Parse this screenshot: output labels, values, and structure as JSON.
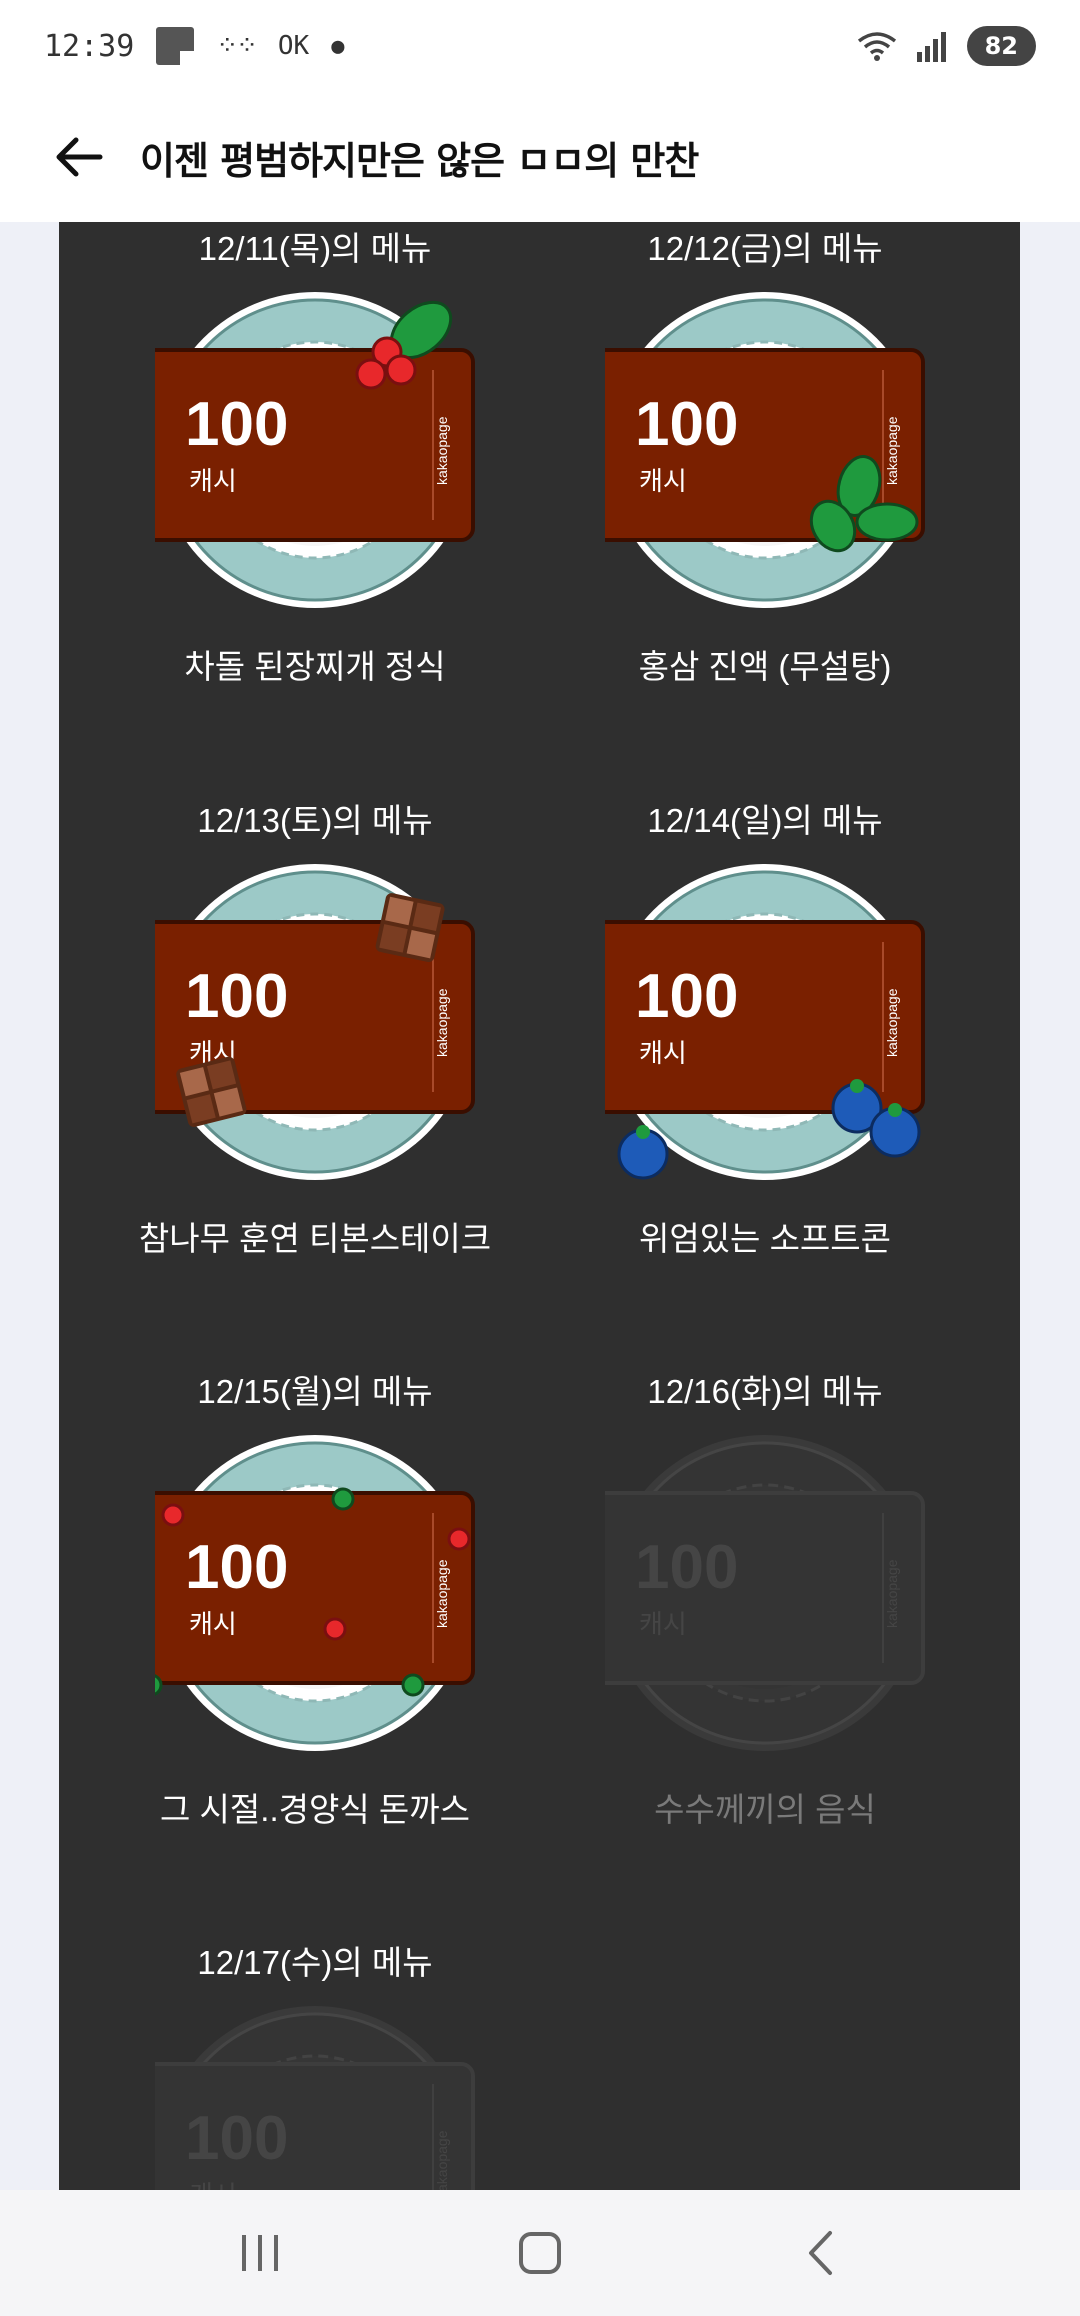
{
  "status": {
    "time": "12:39",
    "ok_label": "OK",
    "battery": "82"
  },
  "header": {
    "title": "이젠 평범하지만은 않은 ㅁㅁ의 만찬"
  },
  "ticket": {
    "amount": "100",
    "unit": "캐시",
    "brand": "kakaopage"
  },
  "menus": [
    {
      "date_label": "12/11(목)의 메뉴",
      "dish": "차돌 된장찌개 정식",
      "locked": false,
      "decoration": "berry-leaf"
    },
    {
      "date_label": "12/12(금)의 메뉴",
      "dish": "홍삼 진액 (무설탕)",
      "locked": false,
      "decoration": "ginseng-leaf"
    },
    {
      "date_label": "12/13(토)의 메뉴",
      "dish": "참나무 훈연 티본스테이크",
      "locked": false,
      "decoration": "chocolate-pieces"
    },
    {
      "date_label": "12/14(일)의 메뉴",
      "dish": "위엄있는 소프트콘",
      "locked": false,
      "decoration": "blueberries"
    },
    {
      "date_label": "12/15(월)의 메뉴",
      "dish": "그 시절..경양식 돈까스",
      "locked": false,
      "decoration": "dots"
    },
    {
      "date_label": "12/16(화)의 메뉴",
      "dish": "수수께끼의 음식",
      "locked": true,
      "decoration": "none"
    },
    {
      "date_label": "12/17(수)의 메뉴",
      "dish": "",
      "locked": true,
      "decoration": "none"
    }
  ],
  "colors": {
    "panel": "#2f2f2f",
    "ticket": "#7a2000",
    "plate_rim": "#9cc9c7",
    "berry": "#e8282b",
    "leaf": "#1f9a3e",
    "blueberry": "#1e5bb8"
  }
}
